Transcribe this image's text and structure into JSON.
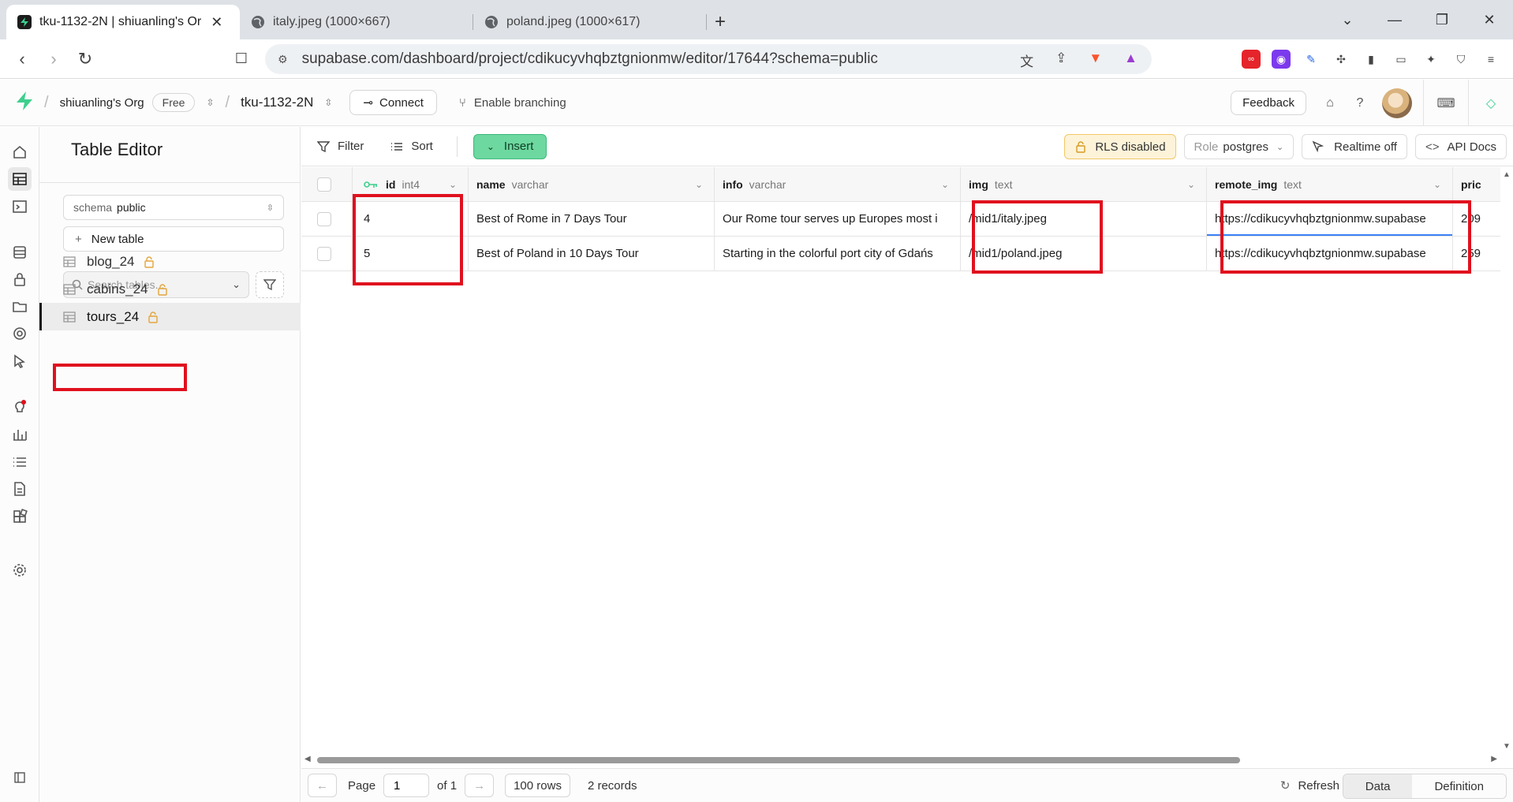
{
  "browser": {
    "tabs": [
      {
        "title": "tku-1132-2N | shiuanling's Or",
        "active": true
      },
      {
        "title": "italy.jpeg (1000×667)",
        "active": false
      },
      {
        "title": "poland.jpeg (1000×617)",
        "active": false
      }
    ],
    "url": "supabase.com/dashboard/project/cdikucyvhqbztgnionmw/editor/17644?schema=public"
  },
  "header": {
    "org": "shiuanling's Org",
    "plan": "Free",
    "project": "tku-1132-2N",
    "connect_label": "Connect",
    "branching_label": "Enable branching",
    "feedback_label": "Feedback"
  },
  "sidebar": {
    "title": "Table Editor",
    "schema_key": "schema",
    "schema_value": "public",
    "new_table_label": "New table",
    "search_placeholder": "Search tables...",
    "tables": [
      {
        "name": "blog_24",
        "active": false
      },
      {
        "name": "cabins_24",
        "active": false
      },
      {
        "name": "tours_24",
        "active": true
      }
    ]
  },
  "toolbar": {
    "filter_label": "Filter",
    "sort_label": "Sort",
    "insert_label": "Insert",
    "rls_label": "RLS disabled",
    "role_key": "Role",
    "role_value": "postgres",
    "realtime_label": "Realtime off",
    "api_docs_label": "API Docs"
  },
  "grid": {
    "columns": [
      {
        "name": "id",
        "type": "int4"
      },
      {
        "name": "name",
        "type": "varchar"
      },
      {
        "name": "info",
        "type": "varchar"
      },
      {
        "name": "img",
        "type": "text"
      },
      {
        "name": "remote_img",
        "type": "text"
      },
      {
        "name": "pric",
        "type": ""
      }
    ],
    "rows": [
      {
        "id": "4",
        "name": "Best of Rome in 7 Days Tour",
        "info": "Our Rome tour serves up Europes most i",
        "img": "/mid1/italy.jpeg",
        "remote_img": "https://cdikucyvhqbztgnionmw.supabase",
        "price": "209"
      },
      {
        "id": "5",
        "name": "Best of Poland in 10 Days Tour",
        "info": "Starting in the colorful port city of Gdańs",
        "img": "/mid1/poland.jpeg",
        "remote_img": "https://cdikucyvhqbztgnionmw.supabase",
        "price": "259"
      }
    ]
  },
  "footer": {
    "page_label": "Page",
    "page_value": "1",
    "of_label": "of 1",
    "rows_label": "100 rows",
    "records_label": "2 records",
    "refresh_label": "Refresh",
    "data_tab": "Data",
    "definition_tab": "Definition"
  },
  "colors": {
    "highlight": "#e0111e",
    "insert_green": "#6dd8a0",
    "brand_green": "#3ecf8e",
    "rls_amber": "#f1c86a"
  }
}
